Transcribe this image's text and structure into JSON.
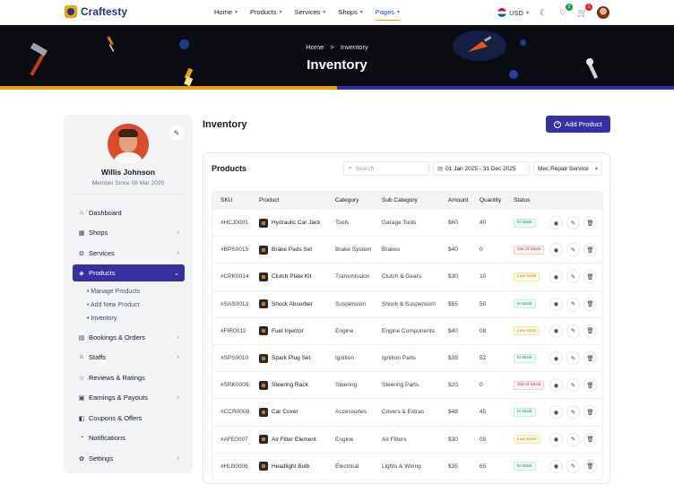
{
  "brand": {
    "name": "Craftesty"
  },
  "nav": {
    "items": [
      {
        "label": "Home"
      },
      {
        "label": "Products"
      },
      {
        "label": "Services"
      },
      {
        "label": "Shops"
      },
      {
        "label": "Pages"
      }
    ],
    "active": "Pages",
    "currency": "USD",
    "wishlist_count": "2",
    "cart_count": "1"
  },
  "hero": {
    "breadcrumb_home": "Home",
    "breadcrumb_sep": ">",
    "breadcrumb_current": "Inventory",
    "title": "Inventory"
  },
  "profile": {
    "name": "Willis Johnson",
    "since": "Member Since 08 Mar 2020"
  },
  "sidebar": {
    "items": [
      {
        "label": "Dashboard",
        "icon": "home-icon",
        "has_chevron": false
      },
      {
        "label": "Shops",
        "icon": "shop-icon",
        "has_chevron": true
      },
      {
        "label": "Services",
        "icon": "services-icon",
        "has_chevron": true
      },
      {
        "label": "Products",
        "icon": "product-icon",
        "has_chevron": true,
        "active": true
      },
      {
        "label": "Bookings & Orders",
        "icon": "calendar-icon",
        "has_chevron": true
      },
      {
        "label": "Staffs",
        "icon": "staff-icon",
        "has_chevron": true
      },
      {
        "label": "Reviews & Ratings",
        "icon": "star-icon",
        "has_chevron": false
      },
      {
        "label": "Earnings & Payouts",
        "icon": "wallet-icon",
        "has_chevron": true
      },
      {
        "label": "Coupons & Offers",
        "icon": "coupon-icon",
        "has_chevron": false
      },
      {
        "label": "Notifications",
        "icon": "bell-icon",
        "has_chevron": false
      },
      {
        "label": "Settings",
        "icon": "gear-icon",
        "has_chevron": true
      }
    ],
    "sub_items": [
      {
        "label": "Manage Products"
      },
      {
        "label": "Add New Product"
      },
      {
        "label": "Inventory",
        "active": true
      }
    ]
  },
  "main": {
    "title": "Inventory",
    "add_button": "Add Product",
    "panel_title": "Products",
    "search_placeholder": "Search",
    "date_range": "01 Jan 2025 - 31 Dec 2025",
    "service_filter": "Mec Repair Service",
    "columns": [
      "SKU",
      "Product",
      "Category",
      "Sub Category",
      "Amount",
      "Quantity",
      "Status"
    ],
    "rows": [
      {
        "sku": "#HCJ0001",
        "product": "Hydraulic Car Jack",
        "category": "Tools",
        "sub": "Garage Tools",
        "amount": "$60",
        "qty": "40",
        "status": "In stock",
        "status_type": "in"
      },
      {
        "sku": "#BPS0015",
        "product": "Brake Pads Set",
        "category": "Brake System",
        "sub": "Brakes",
        "amount": "$40",
        "qty": "0",
        "status": "Out of Stock",
        "status_type": "out"
      },
      {
        "sku": "#CPK0014",
        "product": "Clutch Plate Kit",
        "category": "Transmission",
        "sub": "Clutch & Gears",
        "amount": "$30",
        "qty": "10",
        "status": "Low stock",
        "status_type": "low"
      },
      {
        "sku": "#SAS0013",
        "product": "Shock Absorber",
        "category": "Suspension",
        "sub": "Shock & Suspension",
        "amount": "$55",
        "qty": "50",
        "status": "In stock",
        "status_type": "in"
      },
      {
        "sku": "#FIR0012",
        "product": "Fuel Injector",
        "category": "Engine",
        "sub": "Engine Components",
        "amount": "$40",
        "qty": "08",
        "status": "Low stock",
        "status_type": "low"
      },
      {
        "sku": "#SPS0010",
        "product": "Spark Plug Set",
        "category": "Ignition",
        "sub": "Ignition Parts",
        "amount": "$35",
        "qty": "52",
        "status": "In stock",
        "status_type": "in"
      },
      {
        "sku": "#SRK0009",
        "product": "Steering Rack",
        "category": "Steering",
        "sub": "Steering Parts",
        "amount": "$20",
        "qty": "0",
        "status": "Out of Stock",
        "status_type": "out"
      },
      {
        "sku": "#CCR0008",
        "product": "Car Cover",
        "category": "Accessories",
        "sub": "Covers & Extras",
        "amount": "$48",
        "qty": "45",
        "status": "In stock",
        "status_type": "in"
      },
      {
        "sku": "#AFE0007",
        "product": "Air Filter Element",
        "category": "Engine",
        "sub": "Air Filters",
        "amount": "$30",
        "qty": "05",
        "status": "Low stock",
        "status_type": "low"
      },
      {
        "sku": "#HLB0006",
        "product": "Headlight Bulb",
        "category": "Electrical",
        "sub": "Lights & Wiring",
        "amount": "$35",
        "qty": "65",
        "status": "In stock",
        "status_type": "in"
      }
    ]
  },
  "colors": {
    "primary": "#3730a3",
    "accent": "#f59e0b",
    "in_stock": "#15803d",
    "out_of_stock": "#dc2626",
    "low_stock": "#d97706"
  }
}
